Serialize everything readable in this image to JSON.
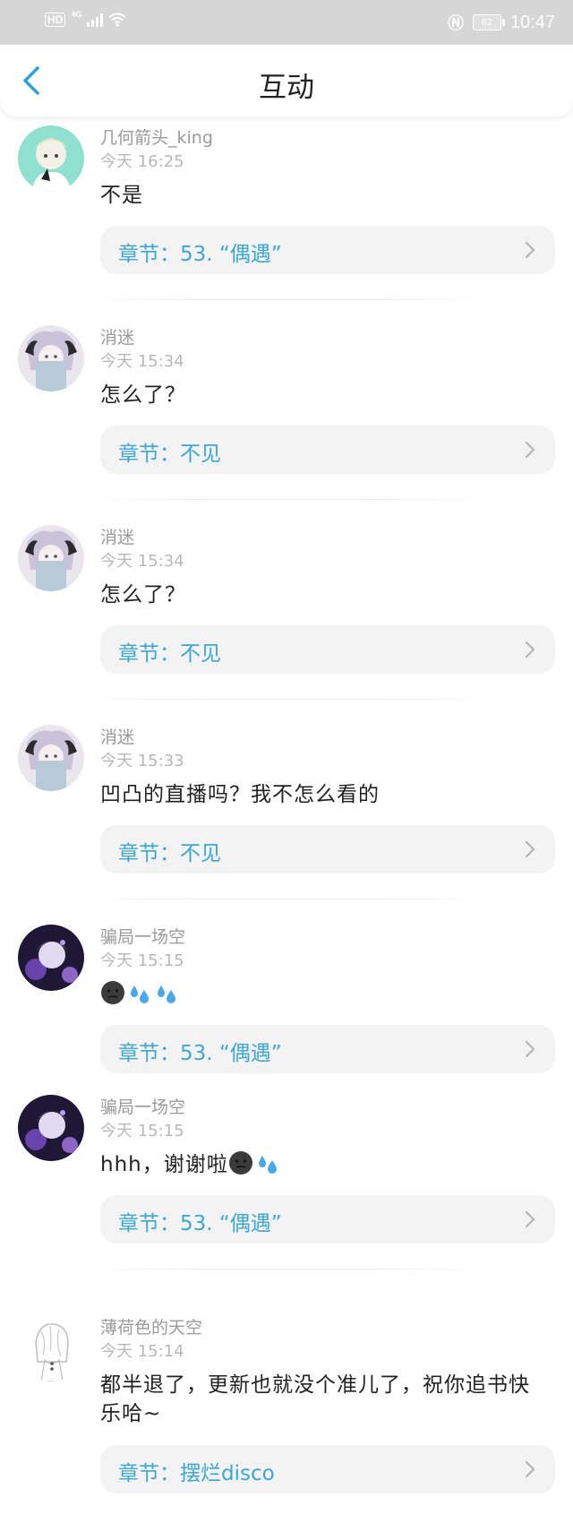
{
  "status_bar": {
    "hd": "HD",
    "network": "4G",
    "battery": "82",
    "time": "10:47"
  },
  "nav": {
    "title": "互动",
    "back_icon": "chevron-left-icon"
  },
  "colors": {
    "accent": "#3ba7d9",
    "status_bar_bg": "#d6d6d6",
    "chapter_bg": "#f3f3f3"
  },
  "comments": [
    {
      "user": "几何箭头_king",
      "time": "今天 16:25",
      "text": "不是",
      "chapter_prefix": "章节：",
      "chapter": "53. “偶遇”"
    },
    {
      "user": "消迷",
      "time": "今天 15:34",
      "text": "怎么了？",
      "chapter_prefix": "章节：",
      "chapter": "不见"
    },
    {
      "user": "消迷",
      "time": "今天 15:34",
      "text": "怎么了？",
      "chapter_prefix": "章节：",
      "chapter": "不见"
    },
    {
      "user": "消迷",
      "time": "今天 15:33",
      "text": "凹凸的直播吗？我不怎么看的",
      "chapter_prefix": "章节：",
      "chapter": "不见"
    },
    {
      "user": "骗局一场空",
      "time": "今天 15:15",
      "text": "",
      "emojis": [
        "dark-face-emoji",
        "sweat-droplets-emoji",
        "sweat-droplets-emoji"
      ],
      "chapter_prefix": "章节：",
      "chapter": "53. “偶遇”"
    },
    {
      "user": "骗局一场空",
      "time": "今天 15:15",
      "text": "hhh，谢谢啦",
      "emojis": [
        "dark-face-emoji",
        "sweat-droplets-emoji"
      ],
      "chapter_prefix": "章节：",
      "chapter": "53. “偶遇”"
    },
    {
      "user": "薄荷色的天空",
      "time": "今天 15:14",
      "text": "都半退了，更新也就没个准儿了，祝你追书快乐哈~",
      "chapter_prefix": "章节：",
      "chapter": "摆烂disco"
    }
  ]
}
